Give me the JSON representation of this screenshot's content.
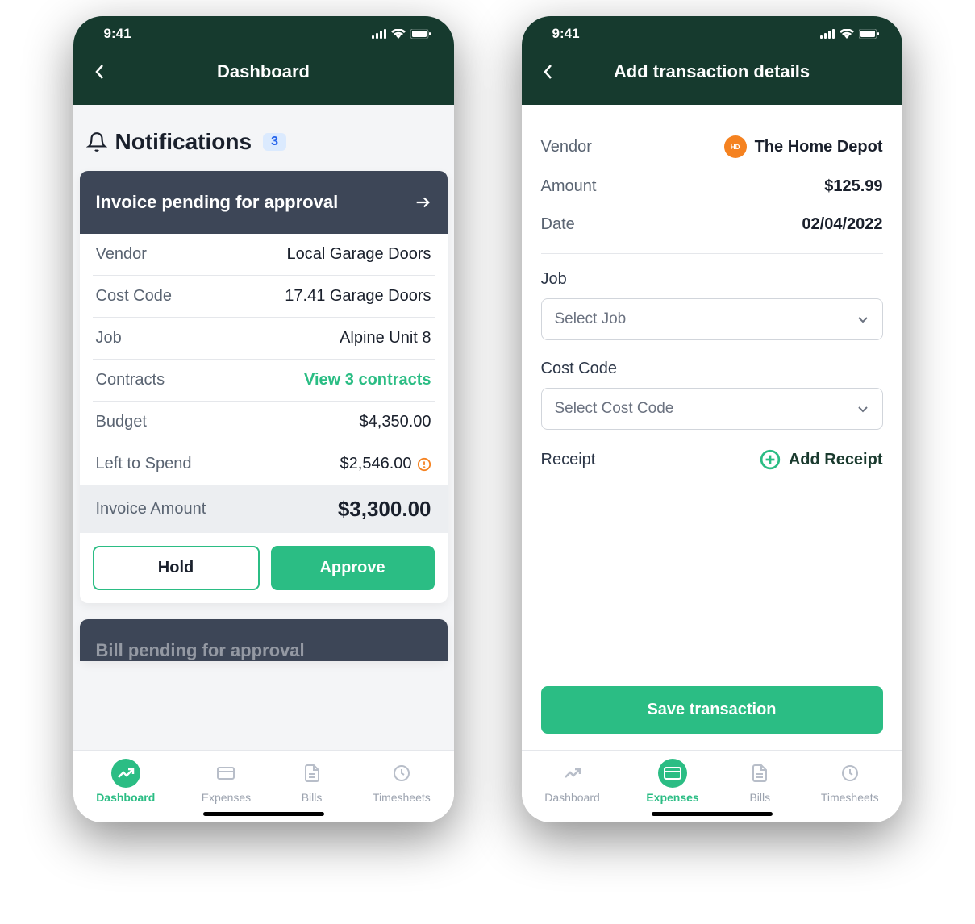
{
  "status": {
    "time": "9:41"
  },
  "screen1": {
    "title": "Dashboard",
    "notifications": {
      "label": "Notifications",
      "count": "3"
    },
    "card1": {
      "title": "Invoice pending for approval",
      "rows": {
        "vendor": {
          "label": "Vendor",
          "value": "Local Garage Doors"
        },
        "costCode": {
          "label": "Cost Code",
          "value": "17.41 Garage Doors"
        },
        "job": {
          "label": "Job",
          "value": "Alpine Unit 8"
        },
        "contracts": {
          "label": "Contracts",
          "value": "View 3 contracts"
        },
        "budget": {
          "label": "Budget",
          "value": "$4,350.00"
        },
        "leftToSpend": {
          "label": "Left to Spend",
          "value": "$2,546.00"
        },
        "invoiceAmount": {
          "label": "Invoice Amount",
          "value": "$3,300.00"
        }
      },
      "actions": {
        "hold": "Hold",
        "approve": "Approve"
      }
    },
    "card2": {
      "title": "Bill pending for approval"
    }
  },
  "screen2": {
    "title": "Add transaction details",
    "details": {
      "vendor": {
        "label": "Vendor",
        "value": "The Home Depot"
      },
      "amount": {
        "label": "Amount",
        "value": "$125.99"
      },
      "date": {
        "label": "Date",
        "value": "02/04/2022"
      }
    },
    "fields": {
      "job": {
        "label": "Job",
        "placeholder": "Select Job"
      },
      "costCode": {
        "label": "Cost Code",
        "placeholder": "Select Cost Code"
      }
    },
    "receipt": {
      "label": "Receipt",
      "action": "Add Receipt"
    },
    "save": "Save transaction"
  },
  "tabs": {
    "dashboard": "Dashboard",
    "expenses": "Expenses",
    "bills": "Bills",
    "timesheets": "Timesheets"
  }
}
